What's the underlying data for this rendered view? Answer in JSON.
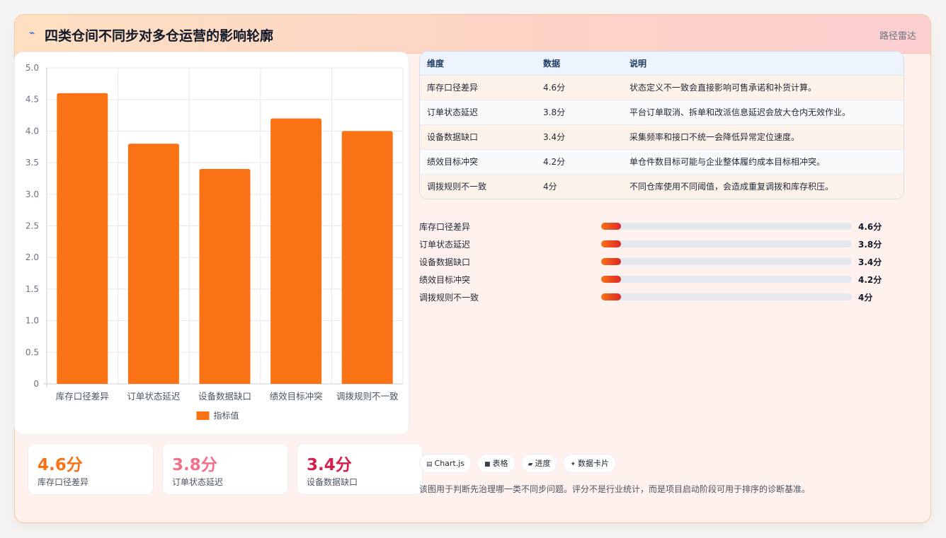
{
  "header": {
    "icon": "line-wave-icon",
    "title": "四类仓间不同步对多仓运营的影响轮廓",
    "right_label": "路径雷达"
  },
  "chart_data": {
    "type": "bar",
    "categories": [
      "库存口径差异",
      "订单状态延迟",
      "设备数据缺口",
      "绩效目标冲突",
      "调拨规则不一致"
    ],
    "series": [
      {
        "name": "指标值",
        "values": [
          4.6,
          3.8,
          3.4,
          4.2,
          4.0
        ]
      }
    ],
    "ylim": [
      0,
      5
    ],
    "yticks": [
      "0",
      "0.5",
      "1.0",
      "1.5",
      "2.0",
      "2.5",
      "3.0",
      "3.5",
      "4.0",
      "4.5",
      "5.0"
    ],
    "grid": true,
    "legend_position": "bottom",
    "bar_color": "#f97316"
  },
  "kpis": [
    {
      "value": "4.6分",
      "label": "库存口径差异",
      "color": "#f97316"
    },
    {
      "value": "3.8分",
      "label": "订单状态延迟",
      "color": "#f07289"
    },
    {
      "value": "3.4分",
      "label": "设备数据缺口",
      "color": "#d51f4c"
    }
  ],
  "table": {
    "headers": [
      "维度",
      "数据",
      "说明"
    ],
    "rows": [
      [
        "库存口径差异",
        "4.6分",
        "状态定义不一致会直接影响可售承诺和补货计算。"
      ],
      [
        "订单状态延迟",
        "3.8分",
        "平台订单取消、拆单和改派信息延迟会放大仓内无效作业。"
      ],
      [
        "设备数据缺口",
        "3.4分",
        "采集频率和接口不统一会降低异常定位速度。"
      ],
      [
        "绩效目标冲突",
        "4.2分",
        "单仓件数目标可能与企业整体履约成本目标相冲突。"
      ],
      [
        "调拨规则不一致",
        "4分",
        "不同仓库使用不同阈值，会造成重复调拨和库存积压。"
      ]
    ]
  },
  "progress": [
    {
      "label": "库存口径差异",
      "value": "4.6分",
      "fill_fraction": 0.08
    },
    {
      "label": "订单状态延迟",
      "value": "3.8分",
      "fill_fraction": 0.08
    },
    {
      "label": "设备数据缺口",
      "value": "3.4分",
      "fill_fraction": 0.08
    },
    {
      "label": "绩效目标冲突",
      "value": "4.2分",
      "fill_fraction": 0.08
    },
    {
      "label": "调拨规则不一致",
      "value": "4分",
      "fill_fraction": 0.08
    }
  ],
  "chips": [
    {
      "icon": "chart-icon",
      "glyph": "▤",
      "label": "Chart.js"
    },
    {
      "icon": "table-icon",
      "glyph": "■",
      "label": "表格"
    },
    {
      "icon": "progress-icon",
      "glyph": "▰",
      "label": "进度"
    },
    {
      "icon": "data-card-icon",
      "glyph": "✦",
      "label": "数据卡片"
    }
  ],
  "footnote": "该图用于判断先治理哪一类不同步问题。评分不是行业统计，而是项目启动阶段可用于排序的诊断基准。"
}
